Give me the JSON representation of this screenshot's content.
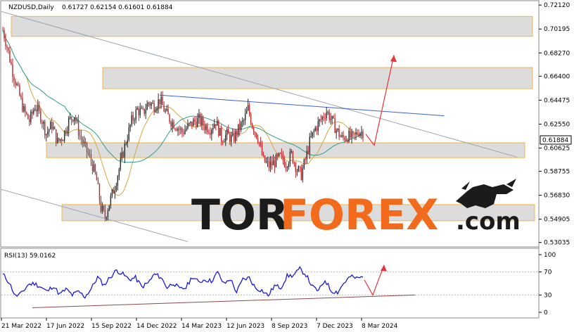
{
  "header": {
    "symbol": "NZDUSD,Daily",
    "ohlc": "0.61727 0.62154 0.61601 0.61884"
  },
  "rsi": {
    "label": "RSI(13) 59.0162",
    "levels": [
      "100",
      "70",
      "30",
      "0"
    ]
  },
  "watermark": {
    "left": "TOR",
    "right": "FOREX",
    "suffix": ".com"
  },
  "colors": {
    "bull": "#2b2b2b",
    "bear": "#c0282d",
    "ma_fast": "#d9a441",
    "ma_slow": "#2f9e8f",
    "rsi": "#1a1adb",
    "arrow": "#e8323c",
    "zone_fill": "#dcdcdc",
    "zone_border": "#f3b44c",
    "trend_blue": "#3b62d6",
    "trend_gray": "#9aa4b0",
    "support": "#8b4a4a",
    "last_price_bg": "#ffffff",
    "brand_dark": "#1b1b1b",
    "brand_orange": "#f26b1d"
  },
  "chart_data": {
    "type": "candlestick",
    "symbol": "NZDUSD",
    "timeframe": "Daily",
    "y_ticks": [
      "0.72120",
      "0.70195",
      "0.68270",
      "0.66400",
      "0.64475",
      "0.62550",
      "0.60625",
      "0.58755",
      "0.56830",
      "0.54905",
      "0.53035"
    ],
    "ylim": [
      0.5285,
      0.723
    ],
    "x_ticks": [
      "21 Mar 2022",
      "17 Jun 2022",
      "15 Sep 2022",
      "14 Dec 2022",
      "14 Mar 2023",
      "12 Jun 2023",
      "8 Sep 2023",
      "7 Dec 2023",
      "8 Mar 2024"
    ],
    "last_price": "0.61884",
    "price_path": [
      [
        0,
        0.701
      ],
      [
        6,
        0.688
      ],
      [
        14,
        0.668
      ],
      [
        22,
        0.652
      ],
      [
        30,
        0.636
      ],
      [
        38,
        0.628
      ],
      [
        46,
        0.64
      ],
      [
        54,
        0.632
      ],
      [
        62,
        0.618
      ],
      [
        70,
        0.625
      ],
      [
        78,
        0.611
      ],
      [
        86,
        0.616
      ],
      [
        94,
        0.628
      ],
      [
        102,
        0.633
      ],
      [
        110,
        0.616
      ],
      [
        118,
        0.606
      ],
      [
        126,
        0.596
      ],
      [
        134,
        0.58
      ],
      [
        140,
        0.558
      ],
      [
        146,
        0.551
      ],
      [
        152,
        0.562
      ],
      [
        160,
        0.576
      ],
      [
        168,
        0.594
      ],
      [
        176,
        0.612
      ],
      [
        184,
        0.628
      ],
      [
        192,
        0.637
      ],
      [
        200,
        0.634
      ],
      [
        208,
        0.643
      ],
      [
        216,
        0.64
      ],
      [
        224,
        0.645
      ],
      [
        232,
        0.635
      ],
      [
        240,
        0.628
      ],
      [
        248,
        0.624
      ],
      [
        256,
        0.619
      ],
      [
        264,
        0.623
      ],
      [
        272,
        0.627
      ],
      [
        280,
        0.629
      ],
      [
        288,
        0.624
      ],
      [
        296,
        0.622
      ],
      [
        304,
        0.628
      ],
      [
        312,
        0.614
      ],
      [
        320,
        0.617
      ],
      [
        328,
        0.613
      ],
      [
        336,
        0.621
      ],
      [
        344,
        0.628
      ],
      [
        350,
        0.638
      ],
      [
        356,
        0.625
      ],
      [
        364,
        0.615
      ],
      [
        372,
        0.596
      ],
      [
        380,
        0.592
      ],
      [
        388,
        0.595
      ],
      [
        396,
        0.599
      ],
      [
        404,
        0.594
      ],
      [
        412,
        0.601
      ],
      [
        420,
        0.589
      ],
      [
        426,
        0.585
      ],
      [
        432,
        0.597
      ],
      [
        438,
        0.611
      ],
      [
        446,
        0.622
      ],
      [
        454,
        0.629
      ],
      [
        462,
        0.636
      ],
      [
        468,
        0.63
      ],
      [
        476,
        0.621
      ],
      [
        484,
        0.614
      ],
      [
        492,
        0.616
      ],
      [
        500,
        0.614
      ],
      [
        508,
        0.62
      ],
      [
        514,
        0.619
      ]
    ],
    "rsi_values": [
      66,
      52,
      28,
      33,
      48,
      50,
      44,
      36,
      46,
      31,
      40,
      30,
      36,
      27,
      41,
      61,
      47,
      61,
      73,
      66,
      57,
      60,
      44,
      51,
      66,
      61,
      43,
      51,
      40,
      43,
      62,
      52,
      57,
      54,
      69,
      49,
      58,
      35,
      57,
      60,
      42,
      38,
      29,
      46,
      43,
      63,
      64,
      75,
      65,
      44,
      37,
      56,
      37,
      35,
      51,
      62,
      59,
      61
    ],
    "levels": {
      "rsi": [
        100,
        70,
        30,
        0
      ]
    }
  }
}
